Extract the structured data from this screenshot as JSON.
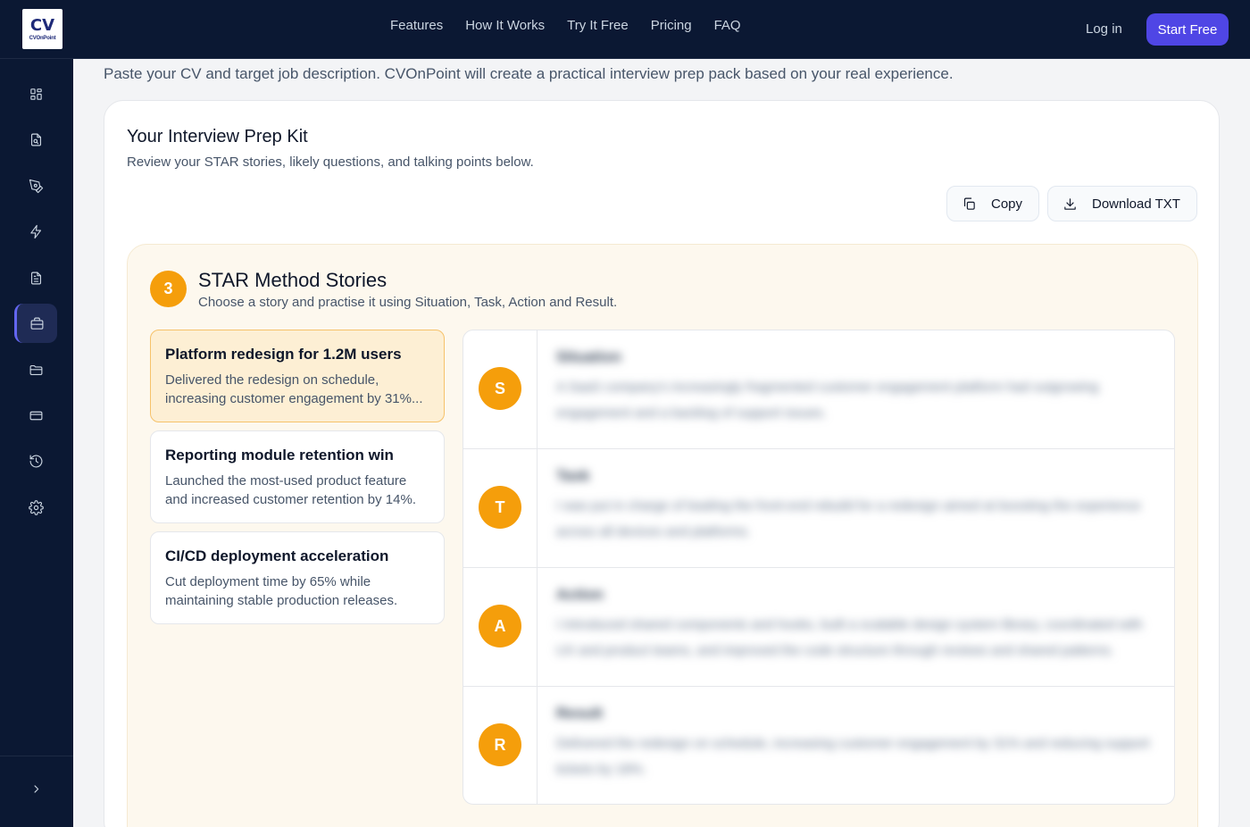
{
  "brand": {
    "logo_mark": "CV",
    "logo_text": "CVOnPoint"
  },
  "nav": {
    "links": [
      "Features",
      "How It Works",
      "Try It Free",
      "Pricing",
      "FAQ"
    ],
    "login": "Log in",
    "start": "Start Free"
  },
  "sidebar": {
    "items": [
      {
        "icon": "dashboard-icon"
      },
      {
        "icon": "document-search-icon"
      },
      {
        "icon": "pen-tool-icon"
      },
      {
        "icon": "lightning-icon"
      },
      {
        "icon": "file-text-icon"
      },
      {
        "icon": "briefcase-icon",
        "active": true
      },
      {
        "icon": "folder-icon"
      },
      {
        "icon": "credit-card-icon"
      },
      {
        "icon": "history-icon"
      },
      {
        "icon": "settings-icon"
      }
    ],
    "expand_icon": "chevron-right-icon"
  },
  "intro": "Paste your CV and target job description. CVOnPoint will create a practical interview prep pack based on your real experience.",
  "kit": {
    "title": "Your Interview Prep Kit",
    "subtitle": "Review your STAR stories, likely questions, and talking points below.",
    "copy_label": "Copy",
    "download_label": "Download TXT"
  },
  "star_section": {
    "badge": "3",
    "title": "STAR Method Stories",
    "subtitle": "Choose a story and practise it using Situation, Task, Action and Result.",
    "stories": [
      {
        "title": "Platform redesign for 1.2M users",
        "desc": "Delivered the redesign on schedule, increasing customer engagement by 31%...",
        "selected": true
      },
      {
        "title": "Reporting module retention win",
        "desc": "Launched the most-used product feature and increased customer retention by 14%."
      },
      {
        "title": "CI/CD deployment acceleration",
        "desc": "Cut deployment time by 65% while maintaining stable production releases."
      }
    ],
    "steps": [
      {
        "letter": "S",
        "label": "Situation",
        "text": "A SaaS company's increasingly fragmented customer engagement platform had outgrowing engagement and a backlog of support issues."
      },
      {
        "letter": "T",
        "label": "Task",
        "text": "I was put in charge of leading the front-end rebuild for a redesign aimed at boosting the experience across all devices and platforms."
      },
      {
        "letter": "A",
        "label": "Action",
        "text": "I introduced shared components and hooks, built a scalable design system library, coordinated with UX and product teams, and improved the code structure through reviews and shared patterns."
      },
      {
        "letter": "R",
        "label": "Result",
        "text": "Delivered the redesign on schedule, increasing customer engagement by 31% and reducing support tickets by 18%."
      }
    ]
  },
  "colors": {
    "accent": "#4f46e5",
    "star": "#f59e0b",
    "nav_bg": "#0b1833"
  }
}
